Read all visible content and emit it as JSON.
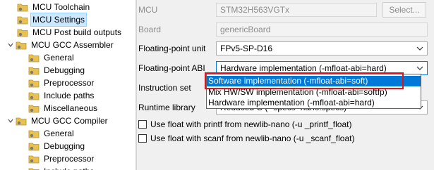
{
  "tree": {
    "items": [
      {
        "label": "MCU Toolchain",
        "level": 1
      },
      {
        "label": "MCU Settings",
        "level": 1,
        "selected": true
      },
      {
        "label": "MCU Post build outputs",
        "level": 1
      },
      {
        "label": "MCU GCC Assembler",
        "level": 1
      },
      {
        "label": "General",
        "level": 2
      },
      {
        "label": "Debugging",
        "level": 2
      },
      {
        "label": "Preprocessor",
        "level": 2
      },
      {
        "label": "Include paths",
        "level": 2
      },
      {
        "label": "Miscellaneous",
        "level": 2
      },
      {
        "label": "MCU GCC Compiler",
        "level": 1
      },
      {
        "label": "General",
        "level": 2
      },
      {
        "label": "Debugging",
        "level": 2
      },
      {
        "label": "Preprocessor",
        "level": 2
      },
      {
        "label": "Include paths",
        "level": 2
      }
    ]
  },
  "form": {
    "mcu_label": "MCU",
    "mcu_value": "STM32H563VGTx",
    "select_button": "Select...",
    "board_label": "Board",
    "board_value": "genericBoard",
    "fpu_label": "Floating-point unit",
    "fpu_value": "FPv5-SP-D16",
    "abi_label": "Floating-point ABI",
    "abi_value": "Hardware implementation (-mfloat-abi=hard)",
    "instruction_set_label": "Instruction set",
    "runtime_label": "Runtime library",
    "runtime_value_partial": "Reduced C (--specs=nano.specs)",
    "printf_checkbox": "Use float with printf from newlib-nano (-u _printf_float)",
    "scanf_checkbox": "Use float with scanf from newlib-nano (-u _scanf_float)"
  },
  "dropdown": {
    "options": [
      "Software implementation (-mfloat-abi=soft)",
      "Mix HW/SW implementation (-mfloat-abi=softfp)",
      "Hardware implementation (-mfloat-abi=hard)"
    ]
  },
  "colors": {
    "selection_blue": "#0078d7",
    "highlight_red": "#e0141e",
    "folder_yellow": "#e8c150"
  }
}
